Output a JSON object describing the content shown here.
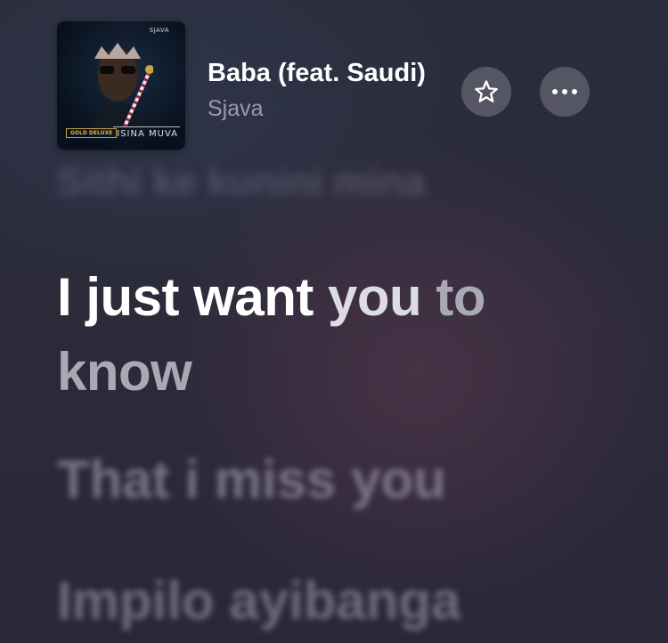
{
  "now_playing": {
    "cover": {
      "artist_mark": "SJAVA",
      "edition_badge": "GOLD DELUXE",
      "album_name": "ISINA MUVA"
    },
    "track_title": "Baba (feat. Saudi)",
    "artist": "Sjava",
    "buttons": {
      "favorite_icon": "star-icon",
      "more_icon": "ellipsis-icon"
    }
  },
  "lyrics": {
    "previous_line": "Sithi ke kunini mina",
    "current_line": {
      "sung": "I just want ",
      "partial": "you",
      "upcoming": " to know"
    },
    "next_lines": [
      "That i miss you",
      "Impilo ayibanga"
    ]
  },
  "colors": {
    "background": "#2b2b3a",
    "text_active": "#ffffff",
    "text_secondary": "#9a9aa6",
    "button_fill": "#78788a"
  }
}
